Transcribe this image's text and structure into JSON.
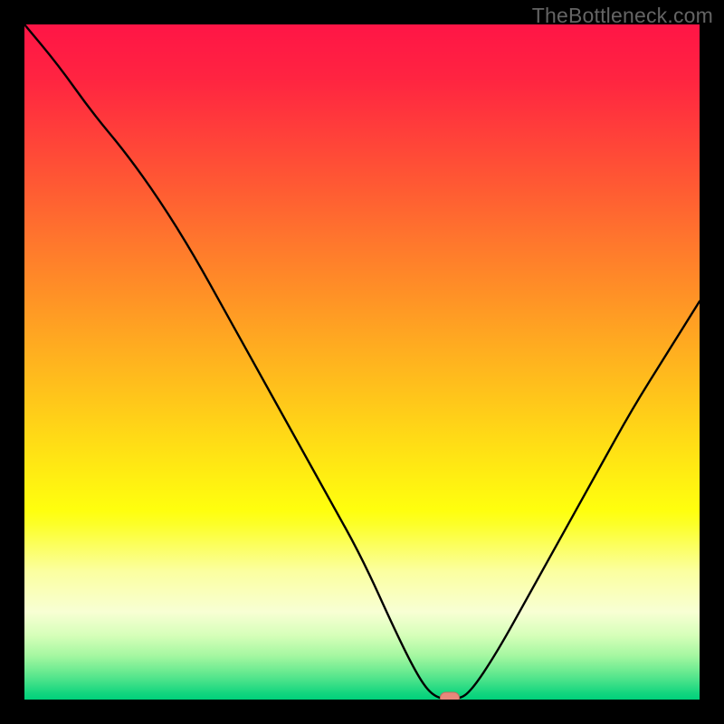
{
  "watermark": "TheBottleneck.com",
  "colors": {
    "frame": "#000000",
    "curve": "#000000",
    "marker_fill": "#e8887b",
    "marker_stroke": "#c46b60",
    "watermark": "#646464",
    "gradient_stops": [
      {
        "offset": 0.0,
        "color": "#ff1546"
      },
      {
        "offset": 0.08,
        "color": "#ff2441"
      },
      {
        "offset": 0.16,
        "color": "#ff3f3a"
      },
      {
        "offset": 0.24,
        "color": "#ff5a33"
      },
      {
        "offset": 0.32,
        "color": "#ff762d"
      },
      {
        "offset": 0.4,
        "color": "#ff9126"
      },
      {
        "offset": 0.48,
        "color": "#ffad20"
      },
      {
        "offset": 0.56,
        "color": "#ffc81a"
      },
      {
        "offset": 0.64,
        "color": "#ffe414"
      },
      {
        "offset": 0.72,
        "color": "#ffff0e"
      },
      {
        "offset": 0.74,
        "color": "#fcff28"
      },
      {
        "offset": 0.81,
        "color": "#fbffa0"
      },
      {
        "offset": 0.87,
        "color": "#f8ffd4"
      },
      {
        "offset": 0.905,
        "color": "#d6ffb9"
      },
      {
        "offset": 0.935,
        "color": "#a5f7a1"
      },
      {
        "offset": 0.958,
        "color": "#6ceb91"
      },
      {
        "offset": 0.975,
        "color": "#3fe088"
      },
      {
        "offset": 0.99,
        "color": "#14d67f"
      },
      {
        "offset": 1.0,
        "color": "#00d17b"
      }
    ]
  },
  "chart_data": {
    "type": "line",
    "title": "",
    "xlabel": "",
    "ylabel": "",
    "xlim": [
      0,
      100
    ],
    "ylim": [
      0,
      100
    ],
    "x": [
      0,
      5,
      10,
      15,
      20,
      25,
      30,
      35,
      40,
      45,
      50,
      55,
      58,
      60,
      62,
      64,
      66,
      70,
      75,
      80,
      85,
      90,
      95,
      100
    ],
    "values": [
      100,
      94,
      87,
      81,
      74,
      66,
      57,
      48,
      39,
      30,
      21,
      10,
      4,
      1,
      0,
      0,
      1,
      7,
      16,
      25,
      34,
      43,
      51,
      59
    ],
    "marker": {
      "x": 63,
      "y": 0,
      "label": "optimal-point"
    }
  }
}
